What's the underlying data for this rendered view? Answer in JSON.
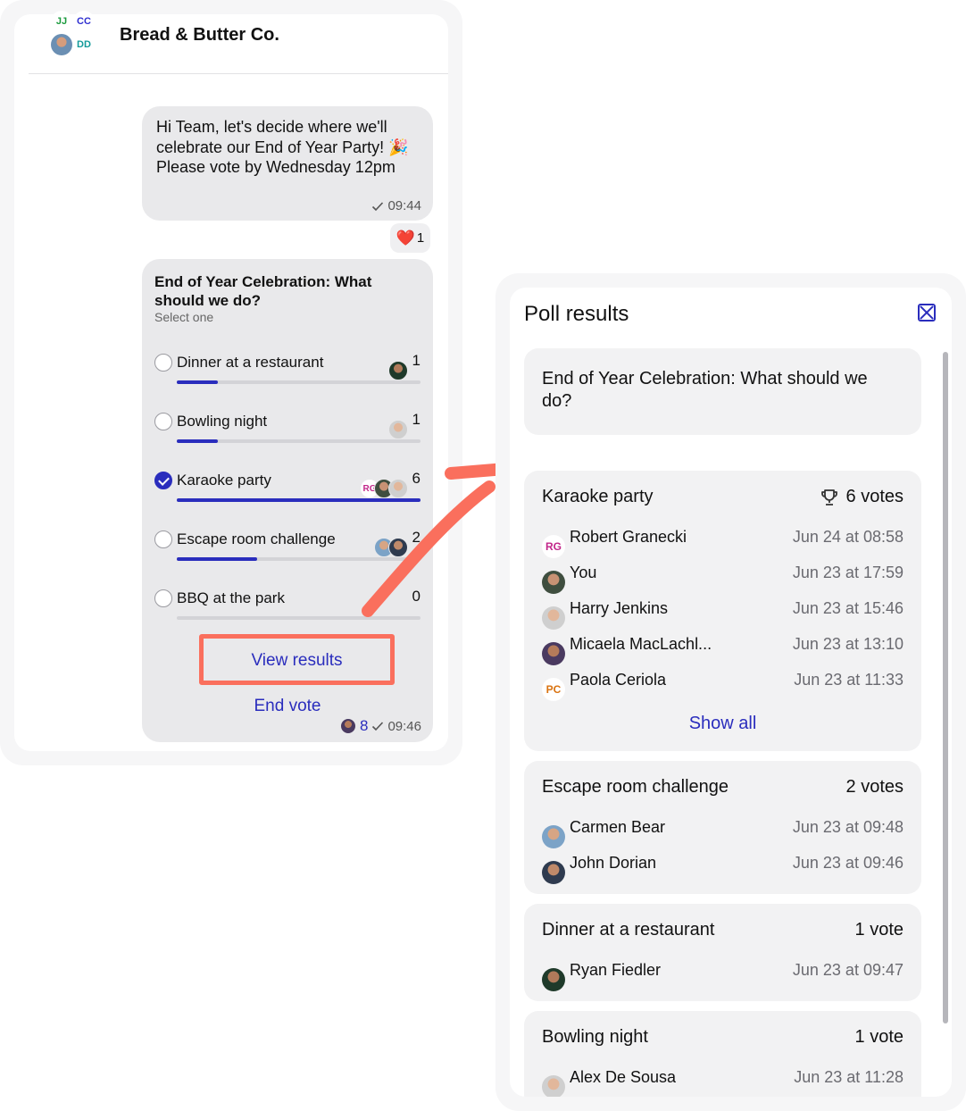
{
  "chat": {
    "group_name": "Bread & Butter Co.",
    "avatar_initials": [
      "JJ",
      "CC",
      "DD"
    ],
    "message": {
      "text": "Hi Team, let's decide where we'll celebrate our End of Year Party! 🎉 Please vote by Wednesday 12pm",
      "time": "09:44"
    },
    "reaction": {
      "emoji": "❤️",
      "count": "1"
    },
    "poll": {
      "question": "End of Year Celebration: What should we do?",
      "hint": "Select one",
      "options": [
        {
          "label": "Dinner at a restaurant",
          "count": "1",
          "fill": 0.17,
          "checked": false
        },
        {
          "label": "Bowling night",
          "count": "1",
          "fill": 0.17,
          "checked": false
        },
        {
          "label": "Karaoke party",
          "count": "6",
          "fill": 1.0,
          "checked": true,
          "initials": "RG"
        },
        {
          "label": "Escape room challenge",
          "count": "2",
          "fill": 0.33,
          "checked": false
        },
        {
          "label": "BBQ at the park",
          "count": "0",
          "fill": 0.0,
          "checked": false
        }
      ],
      "view_results": "View results",
      "end_vote": "End vote",
      "voters_count": "8",
      "time": "09:46"
    }
  },
  "results": {
    "title": "Poll results",
    "question": "End of Year Celebration: What should we do?",
    "show_all": "Show all",
    "groups": [
      {
        "option": "Karaoke party",
        "votes": "6 votes",
        "winner": true,
        "voters": [
          {
            "initials": "RG",
            "name": "Robert Granecki",
            "time": "Jun 24 at 08:58"
          },
          {
            "initials": "",
            "name": "You",
            "time": "Jun 23 at 17:59"
          },
          {
            "initials": "",
            "name": "Harry Jenkins",
            "time": "Jun 23 at 15:46"
          },
          {
            "initials": "",
            "name": "Micaela MacLachl...",
            "time": "Jun 23 at 13:10"
          },
          {
            "initials": "PC",
            "name": "Paola Ceriola",
            "time": "Jun 23 at 11:33"
          }
        ]
      },
      {
        "option": "Escape room challenge",
        "votes": "2 votes",
        "voters": [
          {
            "initials": "",
            "name": "Carmen Bear",
            "time": "Jun 23 at 09:48"
          },
          {
            "initials": "",
            "name": "John Dorian",
            "time": "Jun 23 at 09:46"
          }
        ]
      },
      {
        "option": "Dinner at a restaurant",
        "votes": "1 vote",
        "voters": [
          {
            "initials": "",
            "name": "Ryan Fiedler",
            "time": "Jun 23 at 09:47"
          }
        ]
      },
      {
        "option": "Bowling night",
        "votes": "1 vote",
        "voters": [
          {
            "initials": "",
            "name": "Alex De Sousa",
            "time": "Jun 23 at 11:28"
          }
        ]
      }
    ]
  },
  "colors": {
    "accent": "#2a2dbd",
    "highlight": "#fa6f5d",
    "bubble": "#e9e9eb"
  }
}
